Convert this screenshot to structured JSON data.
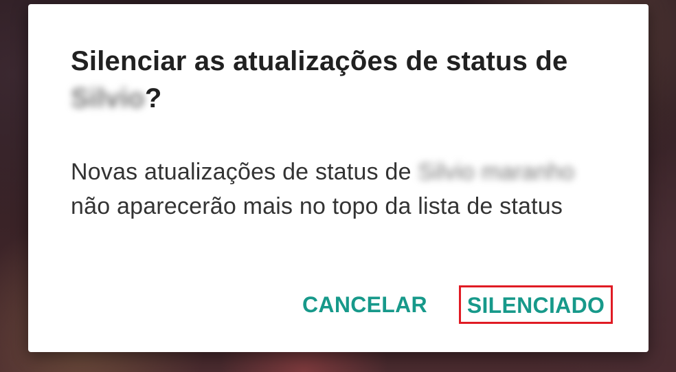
{
  "dialog": {
    "title_prefix": "Silenciar as atualizações de status de",
    "title_name_blurred": "Silvio",
    "title_suffix": "?",
    "message_prefix": "Novas atualizações de status de",
    "message_name_blurred": "Silvio maranho",
    "message_suffix": "não aparecerão mais no topo da lista de status",
    "cancel_label": "CANCELAR",
    "confirm_label": "SILENCIADO"
  },
  "colors": {
    "accent": "#17998a",
    "highlight_border": "#e01b24",
    "title_text": "#212121",
    "body_text": "#333333",
    "dialog_bg": "#ffffff"
  }
}
